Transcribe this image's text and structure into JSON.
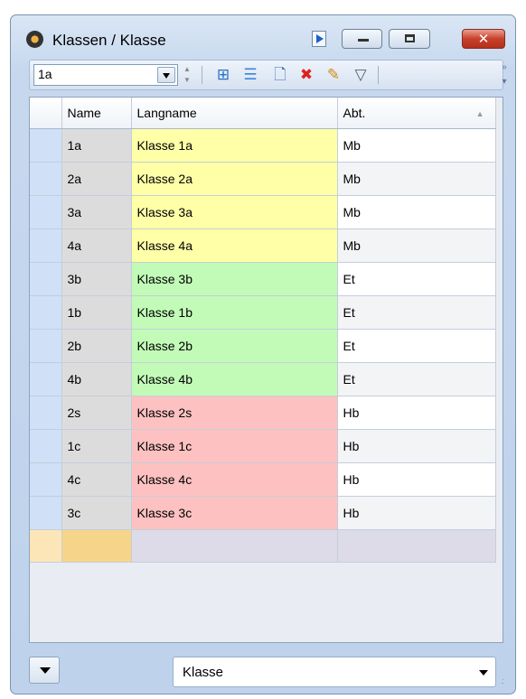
{
  "window": {
    "title": "Klassen / Klasse",
    "icon": "clock-icon",
    "buttons": {
      "minimize": "minimize-icon",
      "maximize": "maximize-icon",
      "close": "close-icon"
    }
  },
  "toolbar": {
    "selected_class": "1a",
    "icons": [
      "add-row-icon",
      "list-icon",
      "new-document-icon",
      "delete-icon",
      "edit-icon",
      "filter-icon"
    ]
  },
  "grid": {
    "columns": [
      "Name",
      "Langname",
      "Abt."
    ],
    "rows": [
      {
        "name": "1a",
        "langname": "Klasse 1a",
        "abt": "Mb",
        "color": "#ffffa8"
      },
      {
        "name": "2a",
        "langname": "Klasse 2a",
        "abt": "Mb",
        "color": "#ffffa8"
      },
      {
        "name": "3a",
        "langname": "Klasse 3a",
        "abt": "Mb",
        "color": "#ffffa8"
      },
      {
        "name": "4a",
        "langname": "Klasse 4a",
        "abt": "Mb",
        "color": "#ffffa8"
      },
      {
        "name": "3b",
        "langname": "Klasse 3b",
        "abt": "Et",
        "color": "#c2fbb8"
      },
      {
        "name": "1b",
        "langname": "Klasse 1b",
        "abt": "Et",
        "color": "#c2fbb8"
      },
      {
        "name": "2b",
        "langname": "Klasse 2b",
        "abt": "Et",
        "color": "#c2fbb8"
      },
      {
        "name": "4b",
        "langname": "Klasse 4b",
        "abt": "Et",
        "color": "#c2fbb8"
      },
      {
        "name": "2s",
        "langname": "Klasse 2s",
        "abt": "Hb",
        "color": "#fdc1c1"
      },
      {
        "name": "1c",
        "langname": "Klasse 1c",
        "abt": "Hb",
        "color": "#fdc1c1"
      },
      {
        "name": "4c",
        "langname": "Klasse 4c",
        "abt": "Hb",
        "color": "#fdc1c1"
      },
      {
        "name": "3c",
        "langname": "Klasse 3c",
        "abt": "Hb",
        "color": "#fdc1c1"
      }
    ]
  },
  "footer": {
    "view_select": "Klasse"
  }
}
